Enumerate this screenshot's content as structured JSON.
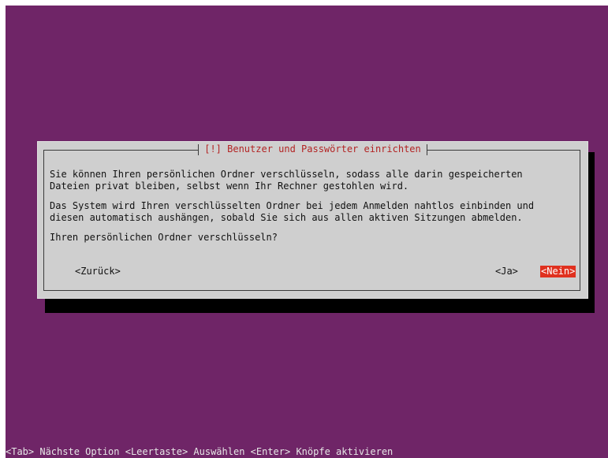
{
  "dialog": {
    "title": "[!] Benutzer und Passwörter einrichten",
    "paragraph1_line1": "Sie können Ihren persönlichen Ordner verschlüsseln, sodass alle darin gespeicherten",
    "paragraph1_line2": "Dateien privat bleiben, selbst wenn Ihr Rechner gestohlen wird.",
    "paragraph2_line1": "Das System wird Ihren verschlüsselten Ordner bei jedem Anmelden nahtlos einbinden und",
    "paragraph2_line2": "diesen automatisch aushängen, sobald Sie sich aus allen aktiven Sitzungen abmelden.",
    "question": "Ihren persönlichen Ordner verschlüsseln?"
  },
  "buttons": {
    "back": "<Zurück>",
    "yes": "<Ja>",
    "no": "<Nein>"
  },
  "status_bar": {
    "text": "<Tab> Nächste Option <Leertaste> Auswählen <Enter> Knöpfe aktivieren"
  },
  "colors": {
    "background": "#6f2567",
    "dialog": "#cfcfcf",
    "title_text": "#b32424",
    "selected_button": "#e0311f"
  }
}
